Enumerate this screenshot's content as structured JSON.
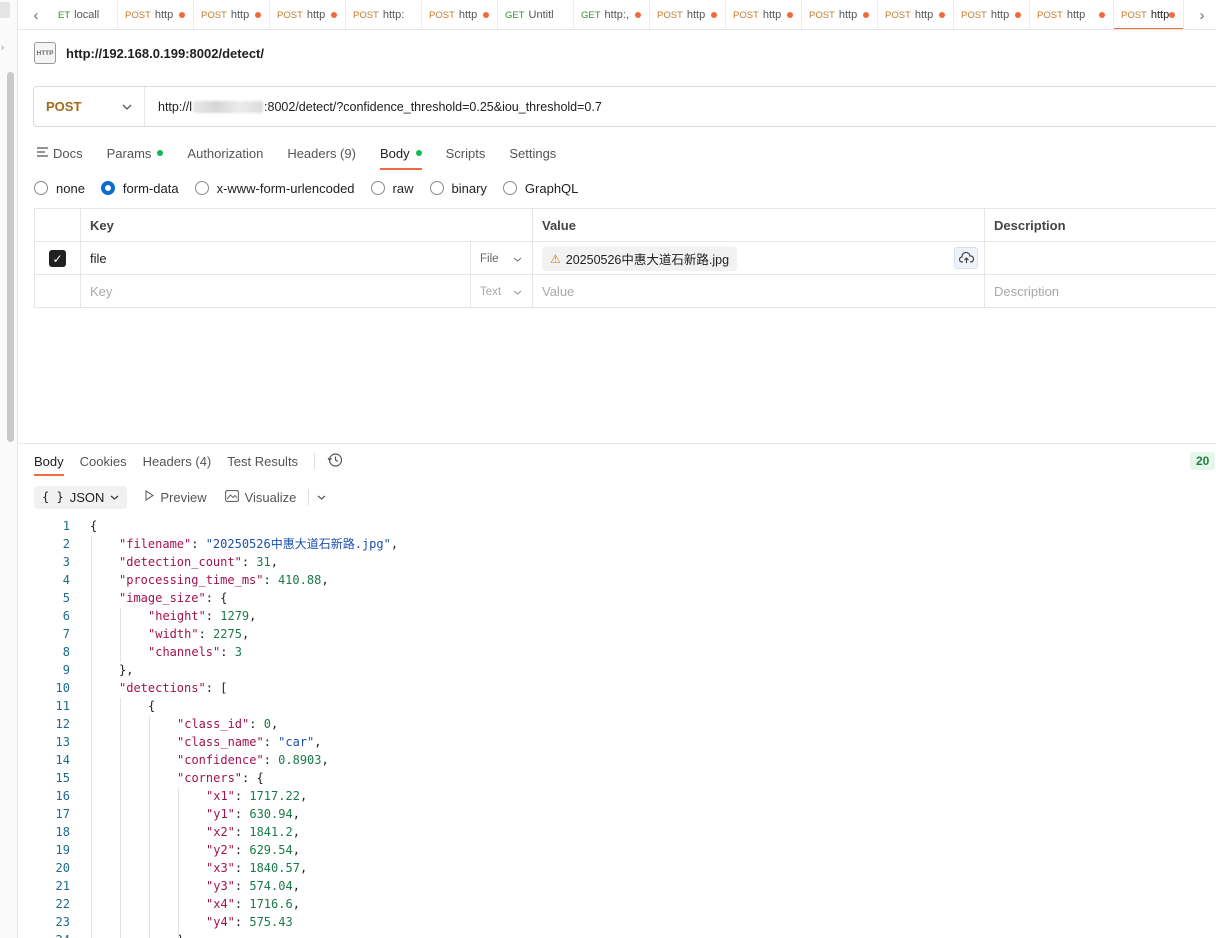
{
  "tabs": [
    {
      "method": "ET",
      "method_type": "get",
      "name": "locall",
      "dot": false
    },
    {
      "method": "POST",
      "method_type": "post",
      "name": "http",
      "dot": true
    },
    {
      "method": "POST",
      "method_type": "post",
      "name": "http",
      "dot": true
    },
    {
      "method": "POST",
      "method_type": "post",
      "name": "http",
      "dot": true
    },
    {
      "method": "POST",
      "method_type": "post",
      "name": "http:",
      "dot": false
    },
    {
      "method": "POST",
      "method_type": "post",
      "name": "http",
      "dot": true
    },
    {
      "method": "GET",
      "method_type": "get",
      "name": "Untitl",
      "dot": false
    },
    {
      "method": "GET",
      "method_type": "get",
      "name": "http:,",
      "dot": true
    },
    {
      "method": "POST",
      "method_type": "post",
      "name": "http",
      "dot": true
    },
    {
      "method": "POST",
      "method_type": "post",
      "name": "http",
      "dot": true
    },
    {
      "method": "POST",
      "method_type": "post",
      "name": "http",
      "dot": true
    },
    {
      "method": "POST",
      "method_type": "post",
      "name": "http",
      "dot": true
    },
    {
      "method": "POST",
      "method_type": "post",
      "name": "http",
      "dot": true
    },
    {
      "method": "POST",
      "method_type": "post",
      "name": "http",
      "dot": true
    },
    {
      "method": "POST",
      "method_type": "post",
      "name": "http",
      "dot": true,
      "active": true
    }
  ],
  "request": {
    "icon_label": "HTTP",
    "title": "http://192.168.0.199:8002/detect/",
    "method": "POST",
    "url_prefix": "http://l",
    "url_suffix": ":8002/detect/?confidence_threshold=0.25&iou_threshold=0.7"
  },
  "request_tabs": [
    {
      "label": "Docs"
    },
    {
      "label": "Params",
      "dot": true
    },
    {
      "label": "Authorization"
    },
    {
      "label": "Headers (9)"
    },
    {
      "label": "Body",
      "dot": true,
      "active": true
    },
    {
      "label": "Scripts"
    },
    {
      "label": "Settings"
    }
  ],
  "body_types": [
    {
      "label": "none"
    },
    {
      "label": "form-data",
      "selected": true
    },
    {
      "label": "x-www-form-urlencoded"
    },
    {
      "label": "raw"
    },
    {
      "label": "binary"
    },
    {
      "label": "GraphQL"
    }
  ],
  "form_table": {
    "headers": {
      "key": "Key",
      "value": "Value",
      "description": "Description"
    },
    "row": {
      "key": "file",
      "type": "File",
      "value": "20250526中惠大道石新路.jpg"
    },
    "empty_row": {
      "key": "Key",
      "type": "Text",
      "value": "Value",
      "description": "Description"
    }
  },
  "response_tabs": [
    {
      "label": "Body",
      "active": true
    },
    {
      "label": "Cookies"
    },
    {
      "label": "Headers (4)"
    },
    {
      "label": "Test Results"
    }
  ],
  "status": "20",
  "view": {
    "format": "JSON",
    "preview": "Preview",
    "visualize": "Visualize"
  },
  "code_lines": [
    {
      "n": "1",
      "i": 0,
      "html": "{"
    },
    {
      "n": "2",
      "i": 1,
      "k": "filename",
      "v": "\"20250526中惠大道石新路.jpg\"",
      "t": "s",
      "tail": ","
    },
    {
      "n": "3",
      "i": 1,
      "k": "detection_count",
      "v": "31",
      "t": "num",
      "tail": ","
    },
    {
      "n": "4",
      "i": 1,
      "k": "processing_time_ms",
      "v": "410.88",
      "t": "num",
      "tail": ","
    },
    {
      "n": "5",
      "i": 1,
      "k": "image_size",
      "v": "{",
      "t": "p",
      "tail": ""
    },
    {
      "n": "6",
      "i": 2,
      "k": "height",
      "v": "1279",
      "t": "num",
      "tail": ","
    },
    {
      "n": "7",
      "i": 2,
      "k": "width",
      "v": "2275",
      "t": "num",
      "tail": ","
    },
    {
      "n": "8",
      "i": 2,
      "k": "channels",
      "v": "3",
      "t": "num",
      "tail": ""
    },
    {
      "n": "9",
      "i": 1,
      "html": "},"
    },
    {
      "n": "10",
      "i": 1,
      "k": "detections",
      "v": "[",
      "t": "p",
      "tail": ""
    },
    {
      "n": "11",
      "i": 2,
      "html": "{"
    },
    {
      "n": "12",
      "i": 3,
      "k": "class_id",
      "v": "0",
      "t": "num",
      "tail": ","
    },
    {
      "n": "13",
      "i": 3,
      "k": "class_name",
      "v": "\"car\"",
      "t": "s",
      "tail": ","
    },
    {
      "n": "14",
      "i": 3,
      "k": "confidence",
      "v": "0.8903",
      "t": "num",
      "tail": ","
    },
    {
      "n": "15",
      "i": 3,
      "k": "corners",
      "v": "{",
      "t": "p",
      "tail": ""
    },
    {
      "n": "16",
      "i": 4,
      "k": "x1",
      "v": "1717.22",
      "t": "num",
      "tail": ","
    },
    {
      "n": "17",
      "i": 4,
      "k": "y1",
      "v": "630.94",
      "t": "num",
      "tail": ","
    },
    {
      "n": "18",
      "i": 4,
      "k": "x2",
      "v": "1841.2",
      "t": "num",
      "tail": ","
    },
    {
      "n": "19",
      "i": 4,
      "k": "y2",
      "v": "629.54",
      "t": "num",
      "tail": ","
    },
    {
      "n": "20",
      "i": 4,
      "k": "x3",
      "v": "1840.57",
      "t": "num",
      "tail": ","
    },
    {
      "n": "21",
      "i": 4,
      "k": "y3",
      "v": "574.04",
      "t": "num",
      "tail": ","
    },
    {
      "n": "22",
      "i": 4,
      "k": "x4",
      "v": "1716.6",
      "t": "num",
      "tail": ","
    },
    {
      "n": "23",
      "i": 4,
      "k": "y4",
      "v": "575.43",
      "t": "num",
      "tail": ""
    },
    {
      "n": "24",
      "i": 3,
      "html": "}"
    }
  ]
}
